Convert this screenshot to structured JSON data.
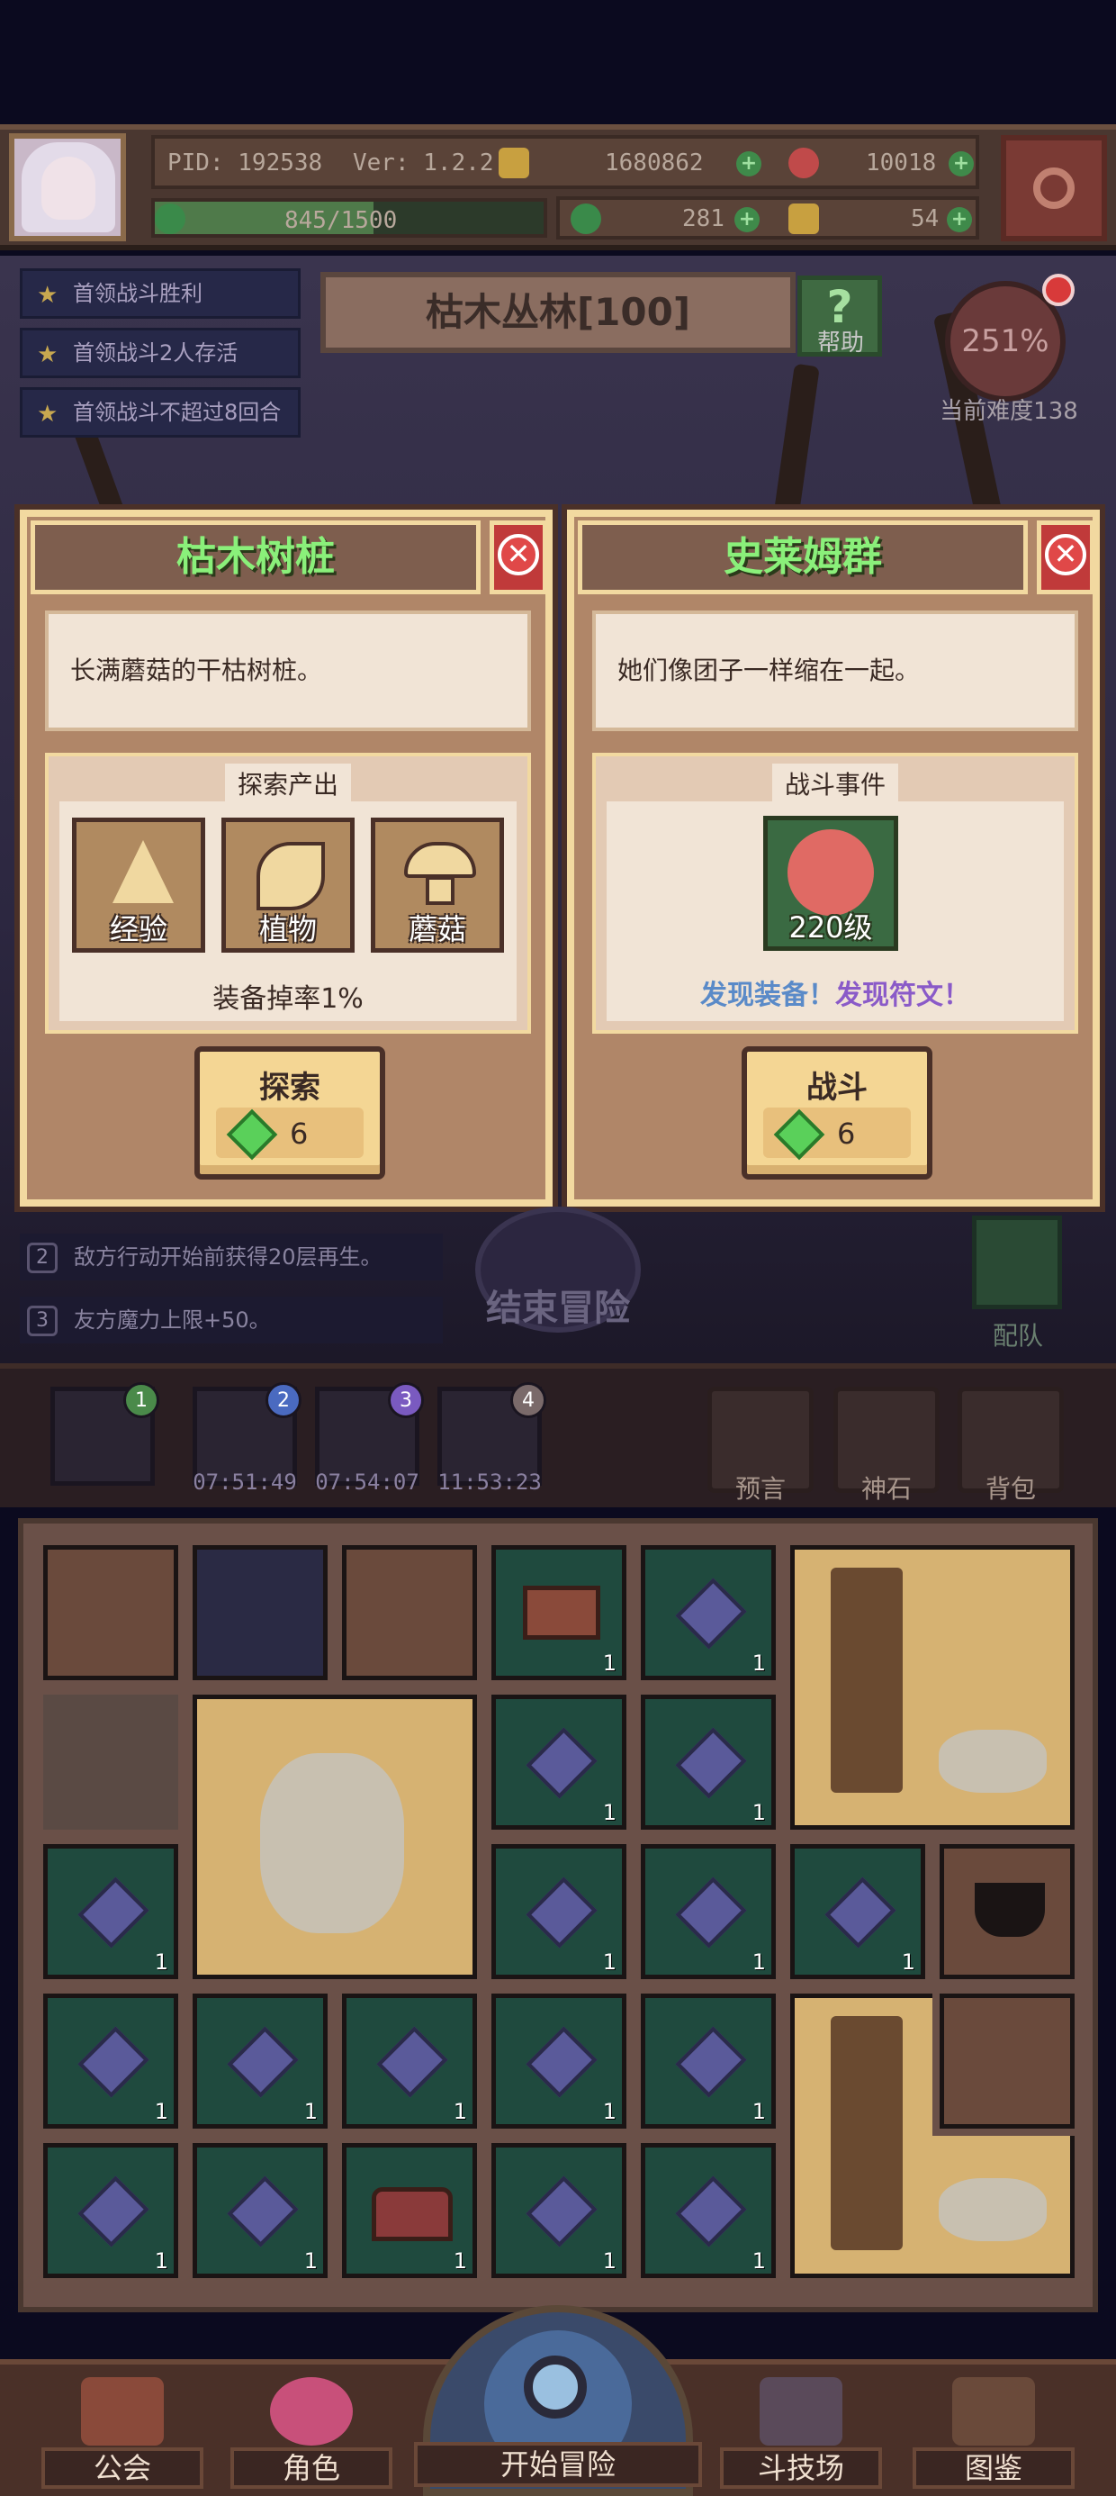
{
  "header": {
    "pid": "PID: 192538",
    "version": "Ver: 1.2.2.1",
    "currency1": "1680862",
    "currency2": "10018",
    "exp": "845/1500",
    "exp_fraction": 0.563,
    "currency3": "281",
    "currency4": "54"
  },
  "objectives": [
    "首领战斗胜利",
    "首领战斗2人存活",
    "首领战斗不超过8回合"
  ],
  "stage": {
    "title": "枯木丛林[100]",
    "help_label": "帮助",
    "difficulty_value": "251%",
    "difficulty_label": "当前难度138"
  },
  "panel_left": {
    "title": "枯木树桩",
    "description": "长满蘑菇的干枯树桩。",
    "section_label": "探索产出",
    "items": [
      "经验",
      "植物",
      "蘑菇"
    ],
    "drop_rate": "装备掉率1%",
    "action_label": "探索",
    "cost": "6"
  },
  "panel_right": {
    "title": "史莱姆群",
    "description": "她们像团子一样缩在一起。",
    "section_label": "战斗事件",
    "monster_level": "220级",
    "found_equipment": "发现装备！",
    "found_rune": "发现符文！",
    "action_label": "战斗",
    "cost": "6"
  },
  "buffs": [
    {
      "num": "2",
      "text": "敌方行动开始前获得20层再生。"
    },
    {
      "num": "3",
      "text": "友方魔力上限+50。"
    }
  ],
  "end_adventure": "结束冒险",
  "team_label": "配队",
  "runs": [
    {
      "num": "1",
      "time": ""
    },
    {
      "num": "2",
      "time": "07:51:49"
    },
    {
      "num": "3",
      "time": "07:54:07"
    },
    {
      "num": "4",
      "time": "11:53:23"
    }
  ],
  "tools": [
    "预言",
    "神石",
    "背包"
  ],
  "board_count": "1",
  "nav": {
    "guild": "公会",
    "character": "角色",
    "start": "开始冒险",
    "arena": "斗技场",
    "codex": "图鉴"
  },
  "colors": {
    "title_green": "#8af07a",
    "found_equipment": "#5a8ac8",
    "found_rune": "#8a5ac8"
  }
}
